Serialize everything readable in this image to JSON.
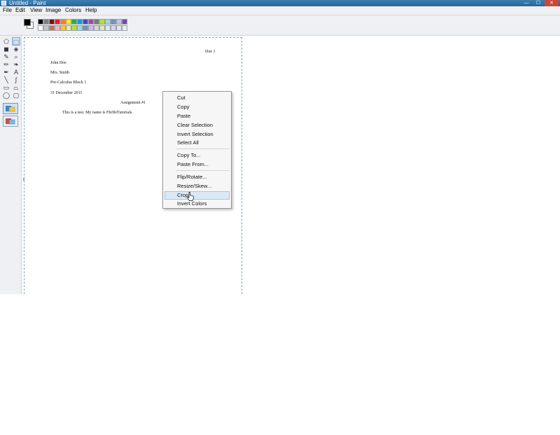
{
  "window": {
    "title": "Untitled - Paint",
    "minimize": "—",
    "maximize": "☐",
    "close": "✕"
  },
  "menubar": [
    "File",
    "Edit",
    "View",
    "Image",
    "Colors",
    "Help"
  ],
  "palette": {
    "foreground": "#000000",
    "background": "#ffffff",
    "row1": [
      "#000000",
      "#7f7f7f",
      "#880015",
      "#ed1c24",
      "#ff7f27",
      "#fff200",
      "#22b14c",
      "#00a2e8",
      "#3f48cc",
      "#a349a4",
      "#7a7a7a",
      "#b5e61d",
      "#99d9ea",
      "#7092be",
      "#c8bfe7",
      "#6b4fa8"
    ],
    "row2": [
      "#ffffff",
      "#c3c3c3",
      "#b97a57",
      "#ffaec9",
      "#ffc90e",
      "#efe4b0",
      "#b5e61d",
      "#99d9ea",
      "#7092be",
      "#c8bfe7",
      "#d7d7d7",
      "#d8ecc2",
      "#dbeef5",
      "#cfd9ea",
      "#e8e2f4",
      "#ececec"
    ]
  },
  "tools": [
    {
      "name": "free-form-select-icon",
      "glyph": "⬠"
    },
    {
      "name": "select-icon",
      "glyph": "⬚"
    },
    {
      "name": "eraser-icon",
      "glyph": "◼"
    },
    {
      "name": "fill-icon",
      "glyph": "◈"
    },
    {
      "name": "color-picker-icon",
      "glyph": "✎"
    },
    {
      "name": "magnifier-icon",
      "glyph": "⌕"
    },
    {
      "name": "pencil-icon",
      "glyph": "✏"
    },
    {
      "name": "brush-icon",
      "glyph": "❧"
    },
    {
      "name": "airbrush-icon",
      "glyph": "✒"
    },
    {
      "name": "text-icon",
      "glyph": "A"
    },
    {
      "name": "line-icon",
      "glyph": "╲"
    },
    {
      "name": "curve-icon",
      "glyph": "∫"
    },
    {
      "name": "rectangle-icon",
      "glyph": "▭"
    },
    {
      "name": "polygon-icon",
      "glyph": "⏢"
    },
    {
      "name": "ellipse-icon",
      "glyph": "◯"
    },
    {
      "name": "rounded-rectangle-icon",
      "glyph": "▢"
    }
  ],
  "document": {
    "header": "Doe 1",
    "name": "John Doe",
    "teacher": "Mrs. Smith",
    "class": "Pre-Calculus Block 1",
    "date": "31 December 2011",
    "assignment": "Assignment #1",
    "body": "This is a test.  My name is FhrffeTutorials."
  },
  "context_menu": {
    "items": [
      "Cut",
      "Copy",
      "Paste",
      "Clear Selection",
      "Invert Selection",
      "Select All",
      "Copy To...",
      "Paste From...",
      "Flip/Rotate...",
      "Resize/Skew...",
      "Crop",
      "Invert Colors"
    ],
    "highlighted": "Crop"
  }
}
